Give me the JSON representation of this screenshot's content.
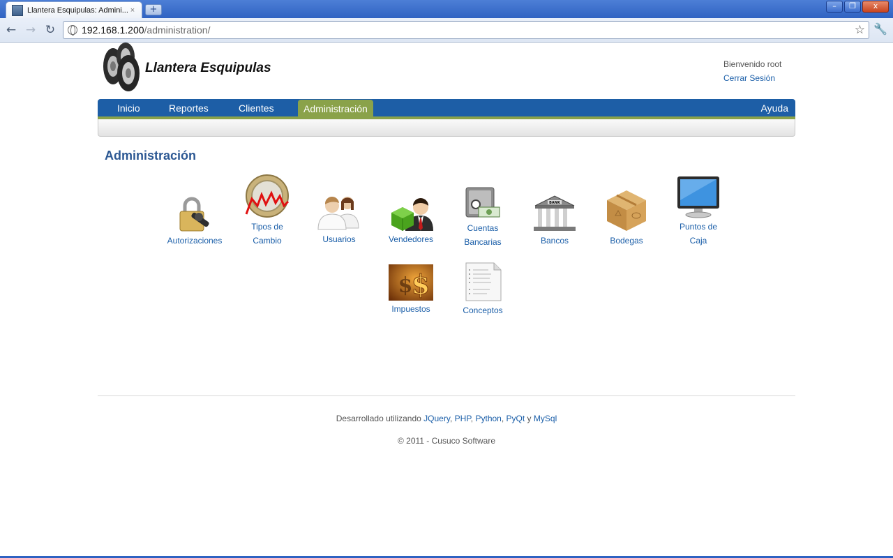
{
  "browser": {
    "tab_title": "Llantera Esquipulas: Admini...",
    "tab_close": "×",
    "new_tab": "+",
    "url_host": "192.168.1.200",
    "url_path": "/administration/",
    "window_buttons": {
      "minimize": "–",
      "maximize": "❐",
      "close": "x"
    }
  },
  "header": {
    "brand": "Llantera Esquipulas",
    "welcome": "Bienvenido root",
    "logout": "Cerrar Sesión"
  },
  "menu": {
    "items": [
      "Inicio",
      "Reportes",
      "Clientes",
      "Administración"
    ],
    "active": "Administración",
    "help": "Ayuda"
  },
  "main": {
    "title": "Administración",
    "icons": [
      {
        "label1": "Autorizaciones",
        "label2": "",
        "icon": "padlock-key-icon"
      },
      {
        "label1": "Tipos de",
        "label2": "Cambio",
        "icon": "coin-chart-icon"
      },
      {
        "label1": "Usuarios",
        "label2": "",
        "icon": "users-icon"
      },
      {
        "label1": "Vendedores",
        "label2": "",
        "icon": "salesman-icon"
      },
      {
        "label1": "Cuentas",
        "label2": "Bancarias",
        "icon": "safe-money-icon"
      },
      {
        "label1": "Bancos",
        "label2": "",
        "icon": "bank-building-icon"
      },
      {
        "label1": "Bodegas",
        "label2": "",
        "icon": "box-icon"
      },
      {
        "label1": "Puntos de",
        "label2": "Caja",
        "icon": "monitor-icon"
      },
      {
        "label1": "Impuestos",
        "label2": "",
        "icon": "dollar-sign-icon"
      },
      {
        "label1": "Conceptos",
        "label2": "",
        "icon": "document-list-icon"
      }
    ]
  },
  "footer": {
    "dev_prefix": "Desarrollado utilizando",
    "tech": [
      "JQuery",
      "PHP",
      "Python",
      "PyQt",
      "MySql"
    ],
    "sep_comma": ",",
    "sep_and": "y",
    "copyright": "© 2011 - Cusuco Software"
  },
  "colors": {
    "menu_blue": "#1d5ea6",
    "menu_active_green": "#8aa24a",
    "link_blue": "#1a5ea8",
    "heading_blue": "#2c5893"
  }
}
